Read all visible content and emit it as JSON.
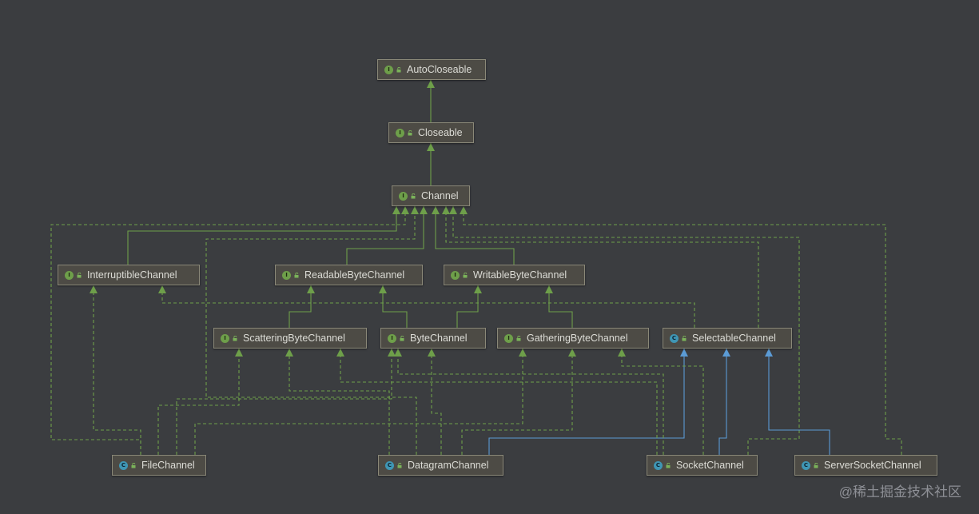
{
  "nodes": [
    {
      "id": "AutoCloseable",
      "label": "AutoCloseable",
      "kind": "I"
    },
    {
      "id": "Closeable",
      "label": "Closeable",
      "kind": "I"
    },
    {
      "id": "Channel",
      "label": "Channel",
      "kind": "I"
    },
    {
      "id": "InterruptibleChannel",
      "label": "InterruptibleChannel",
      "kind": "I"
    },
    {
      "id": "ReadableByteChannel",
      "label": "ReadableByteChannel",
      "kind": "I"
    },
    {
      "id": "WritableByteChannel",
      "label": "WritableByteChannel",
      "kind": "I"
    },
    {
      "id": "ScatteringByteChannel",
      "label": "ScatteringByteChannel",
      "kind": "I"
    },
    {
      "id": "ByteChannel",
      "label": "ByteChannel",
      "kind": "I"
    },
    {
      "id": "GatheringByteChannel",
      "label": "GatheringByteChannel",
      "kind": "I"
    },
    {
      "id": "SelectableChannel",
      "label": "SelectableChannel",
      "kind": "C"
    },
    {
      "id": "FileChannel",
      "label": "FileChannel",
      "kind": "C"
    },
    {
      "id": "DatagramChannel",
      "label": "DatagramChannel",
      "kind": "C"
    },
    {
      "id": "SocketChannel",
      "label": "SocketChannel",
      "kind": "C"
    },
    {
      "id": "ServerSocketChannel",
      "label": "ServerSocketChannel",
      "kind": "C"
    }
  ],
  "edges": [
    {
      "from": "Closeable",
      "to": "AutoCloseable",
      "type": "extends"
    },
    {
      "from": "Channel",
      "to": "Closeable",
      "type": "extends"
    },
    {
      "from": "InterruptibleChannel",
      "to": "Channel",
      "type": "extends"
    },
    {
      "from": "ReadableByteChannel",
      "to": "Channel",
      "type": "extends"
    },
    {
      "from": "WritableByteChannel",
      "to": "Channel",
      "type": "extends"
    },
    {
      "from": "ScatteringByteChannel",
      "to": "ReadableByteChannel",
      "type": "extends"
    },
    {
      "from": "ByteChannel",
      "to": "ReadableByteChannel",
      "type": "extends"
    },
    {
      "from": "ByteChannel",
      "to": "WritableByteChannel",
      "type": "extends"
    },
    {
      "from": "GatheringByteChannel",
      "to": "WritableByteChannel",
      "type": "extends"
    },
    {
      "from": "SelectableChannel",
      "to": "Channel",
      "type": "implements"
    },
    {
      "from": "SelectableChannel",
      "to": "InterruptibleChannel",
      "type": "implements"
    },
    {
      "from": "FileChannel",
      "to": "Channel",
      "type": "implements"
    },
    {
      "from": "FileChannel",
      "to": "InterruptibleChannel",
      "type": "implements"
    },
    {
      "from": "FileChannel",
      "to": "ScatteringByteChannel",
      "type": "implements"
    },
    {
      "from": "FileChannel",
      "to": "ByteChannel",
      "type": "implements"
    },
    {
      "from": "FileChannel",
      "to": "GatheringByteChannel",
      "type": "implements"
    },
    {
      "from": "DatagramChannel",
      "to": "Channel",
      "type": "implements"
    },
    {
      "from": "DatagramChannel",
      "to": "ScatteringByteChannel",
      "type": "implements"
    },
    {
      "from": "DatagramChannel",
      "to": "ByteChannel",
      "type": "implements"
    },
    {
      "from": "DatagramChannel",
      "to": "GatheringByteChannel",
      "type": "implements"
    },
    {
      "from": "DatagramChannel",
      "to": "SelectableChannel",
      "type": "extends-class"
    },
    {
      "from": "SocketChannel",
      "to": "Channel",
      "type": "implements"
    },
    {
      "from": "SocketChannel",
      "to": "ScatteringByteChannel",
      "type": "implements"
    },
    {
      "from": "SocketChannel",
      "to": "ByteChannel",
      "type": "implements"
    },
    {
      "from": "SocketChannel",
      "to": "GatheringByteChannel",
      "type": "implements"
    },
    {
      "from": "SocketChannel",
      "to": "SelectableChannel",
      "type": "extends-class"
    },
    {
      "from": "ServerSocketChannel",
      "to": "Channel",
      "type": "implements"
    },
    {
      "from": "ServerSocketChannel",
      "to": "SelectableChannel",
      "type": "extends-class"
    }
  ],
  "colors": {
    "background": "#3b3d40",
    "extends_line": "#6e9f4a",
    "implements_line": "#6e9f4a",
    "class_extends_line": "#5b9bd5",
    "interface_badge": "#6e9f4a",
    "class_badge": "#3f96b4"
  },
  "icons": {
    "interface": "interface-badge-icon",
    "class": "class-badge-icon",
    "visibility": "open-lock-icon"
  },
  "watermark": "@稀土掘金技术社区"
}
